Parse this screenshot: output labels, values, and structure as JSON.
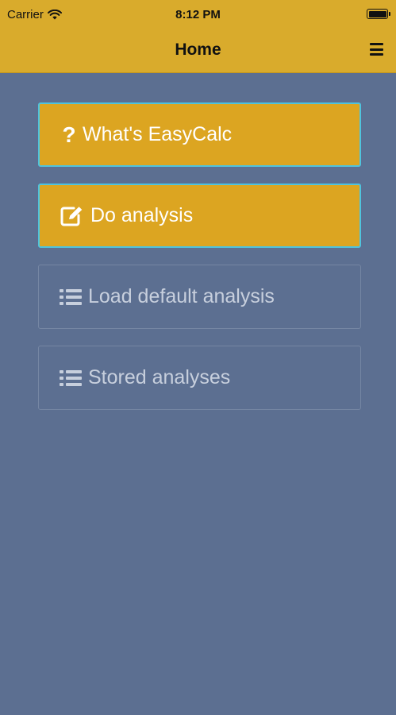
{
  "status_bar": {
    "carrier": "Carrier",
    "time": "8:12 PM"
  },
  "navbar": {
    "title": "Home",
    "menu_icon": "hamburger-menu-icon"
  },
  "menu_items": [
    {
      "label": "What's EasyCalc",
      "icon": "question-icon",
      "state": "active"
    },
    {
      "label": "Do analysis",
      "icon": "edit-icon",
      "state": "active"
    },
    {
      "label": "Load default analysis",
      "icon": "list-icon",
      "state": "inactive"
    },
    {
      "label": "Stored analyses",
      "icon": "list-icon",
      "state": "inactive"
    }
  ],
  "colors": {
    "background": "#5c6f91",
    "header": "#d9ab2c",
    "button_active": "#dca521",
    "button_active_border": "#4fc3dd",
    "button_inactive_border": "#7586a3"
  }
}
